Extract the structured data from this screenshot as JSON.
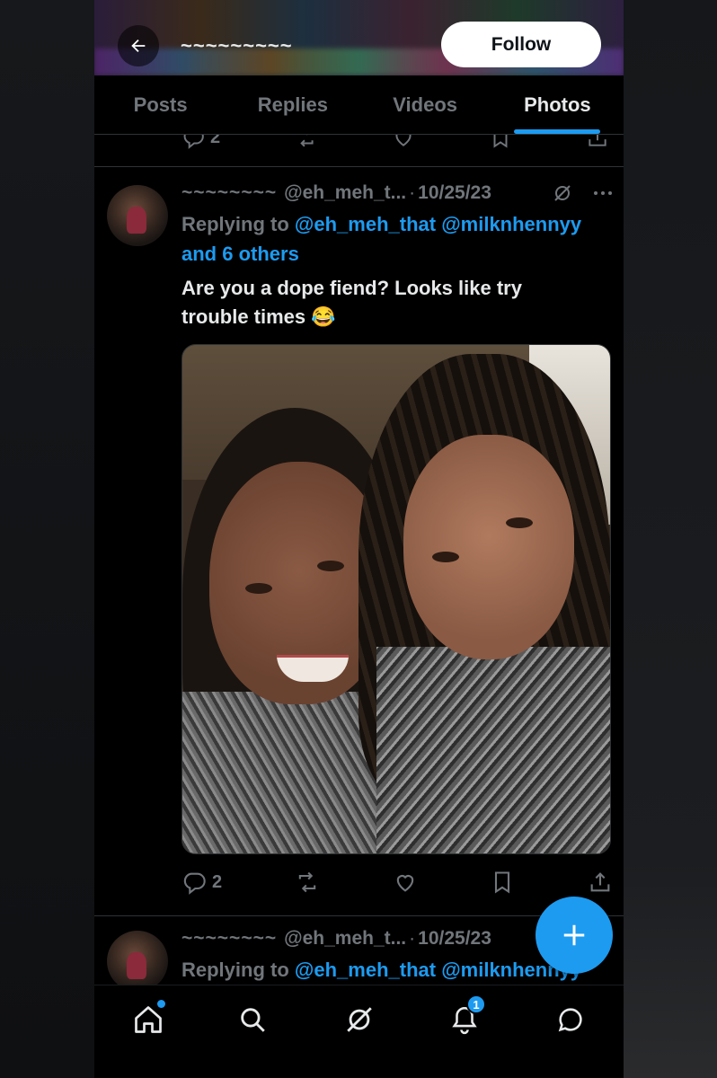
{
  "header": {
    "display_name": "~~~~~~~~~",
    "follow_label": "Follow"
  },
  "tabs": [
    {
      "label": "Posts",
      "active": false
    },
    {
      "label": "Replies",
      "active": false
    },
    {
      "label": "Videos",
      "active": false
    },
    {
      "label": "Photos",
      "active": true
    }
  ],
  "previous_tweet": {
    "reply_count": "2"
  },
  "tweet": {
    "display_name": "~~~~~~~~",
    "handle": "@eh_meh_t...",
    "separator": "·",
    "date": "10/25/23",
    "replying_prefix": "Replying to",
    "reply_links": [
      "@eh_meh_that",
      "@milknhennyy",
      "and 6 others"
    ],
    "text_line1": "Are you a dope fiend? Looks like try",
    "text_line2": "trouble times 😂",
    "photo_icon": "selfie-photo",
    "reply_count": "2",
    "icons": [
      "reply-icon",
      "retweet-icon",
      "like-icon",
      "bookmark-icon",
      "share-icon"
    ]
  },
  "next_tweet": {
    "display_name": "~~~~~~~~",
    "handle": "@eh_meh_t...",
    "separator": "·",
    "date": "10/25/23",
    "replying_prefix": "Replying to",
    "reply_links": [
      "@eh_meh_that",
      "@milknhennyy"
    ]
  },
  "bottom_nav": {
    "items": [
      "home-icon",
      "search-icon",
      "grok-icon",
      "notifications-icon",
      "messages-icon"
    ],
    "notifications_badge": "1"
  },
  "colors": {
    "accent": "#1d9bf0",
    "background": "#000000",
    "muted_text": "#71767b",
    "text": "#e7e9ea"
  }
}
